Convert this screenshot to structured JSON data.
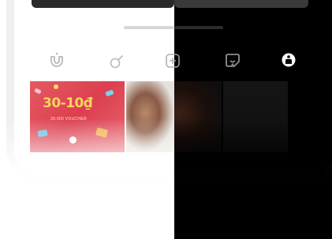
{
  "theme": {
    "light_bg": "#ffffff",
    "dark_bg": "#000000",
    "icon_light": "#b9b9b9",
    "icon_dark": "#8e8e8e",
    "icon_dark_active": "#ffffff"
  },
  "toolbar": {
    "icons": [
      {
        "name": "brush-icon"
      },
      {
        "name": "pin-icon"
      },
      {
        "name": "add-photo-icon"
      },
      {
        "name": "sticker-icon"
      },
      {
        "name": "info-icon"
      }
    ]
  },
  "gallery": {
    "sale_banner": {
      "headline": "30-10₫",
      "subtext": "30.000 VOUCHER"
    }
  }
}
